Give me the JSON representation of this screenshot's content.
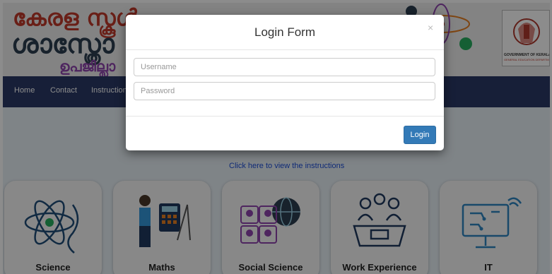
{
  "header": {
    "title_line1": "കേരള സ്കൂൾ",
    "title_line2": "ശാസ്ത്രോ",
    "title_line3": "ഉപജില്ലാ",
    "emblem_text1": "GOVERNMENT OF KERALA",
    "emblem_text2": "GENERAL EDUCATION DEPARTMENT"
  },
  "nav": {
    "items": [
      "Home",
      "Contact",
      "Instruction"
    ]
  },
  "content": {
    "instructions_link": "Click here to view the instructions"
  },
  "cards": [
    {
      "label": "Science",
      "icon": "atom-dna-icon"
    },
    {
      "label": "Maths",
      "icon": "maths-teacher-icon"
    },
    {
      "label": "Social Science",
      "icon": "globe-people-icon"
    },
    {
      "label": "Work Experience",
      "icon": "meeting-table-icon"
    },
    {
      "label": "IT",
      "icon": "computer-circuit-icon"
    }
  ],
  "modal": {
    "title": "Login Form",
    "close_symbol": "×",
    "username_placeholder": "Username",
    "password_placeholder": "Password",
    "login_label": "Login"
  },
  "colors": {
    "navbar": "#2b3a67",
    "primary_button": "#337ab7",
    "link": "#1d4ed8"
  }
}
